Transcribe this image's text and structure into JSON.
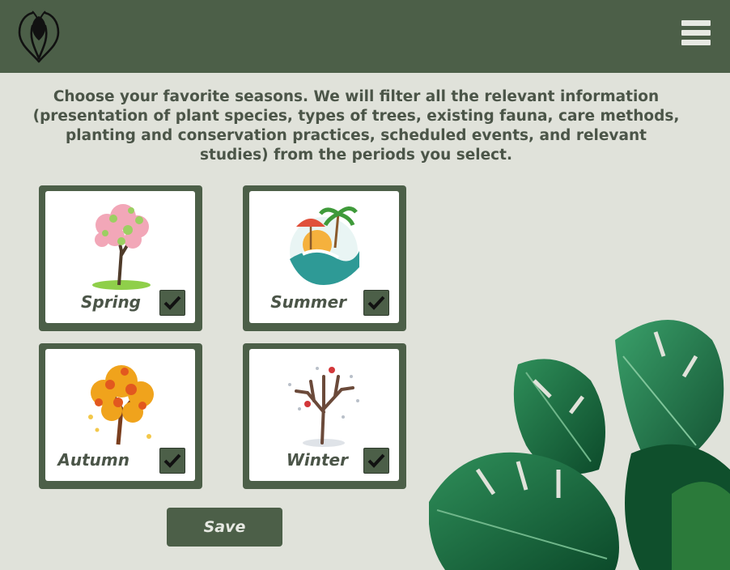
{
  "header": {
    "logo_icon": "flower-logo-icon",
    "menu_icon": "hamburger-menu-icon",
    "bar_color": "#4c5f48"
  },
  "intro": {
    "text": "Choose your favorite seasons. We will filter all the relevant information (presentation of plant species, types of trees, existing fauna, care methods, planting and conservation practices, scheduled events, and relevant studies) from the periods you select."
  },
  "seasons": [
    {
      "label": "Spring",
      "checked": true,
      "icon": "spring-tree-icon"
    },
    {
      "label": "Summer",
      "checked": true,
      "icon": "beach-icon"
    },
    {
      "label": "Autumn",
      "checked": true,
      "icon": "autumn-tree-icon"
    },
    {
      "label": "Winter",
      "checked": true,
      "icon": "winter-tree-icon"
    }
  ],
  "save": {
    "label": "Save"
  }
}
